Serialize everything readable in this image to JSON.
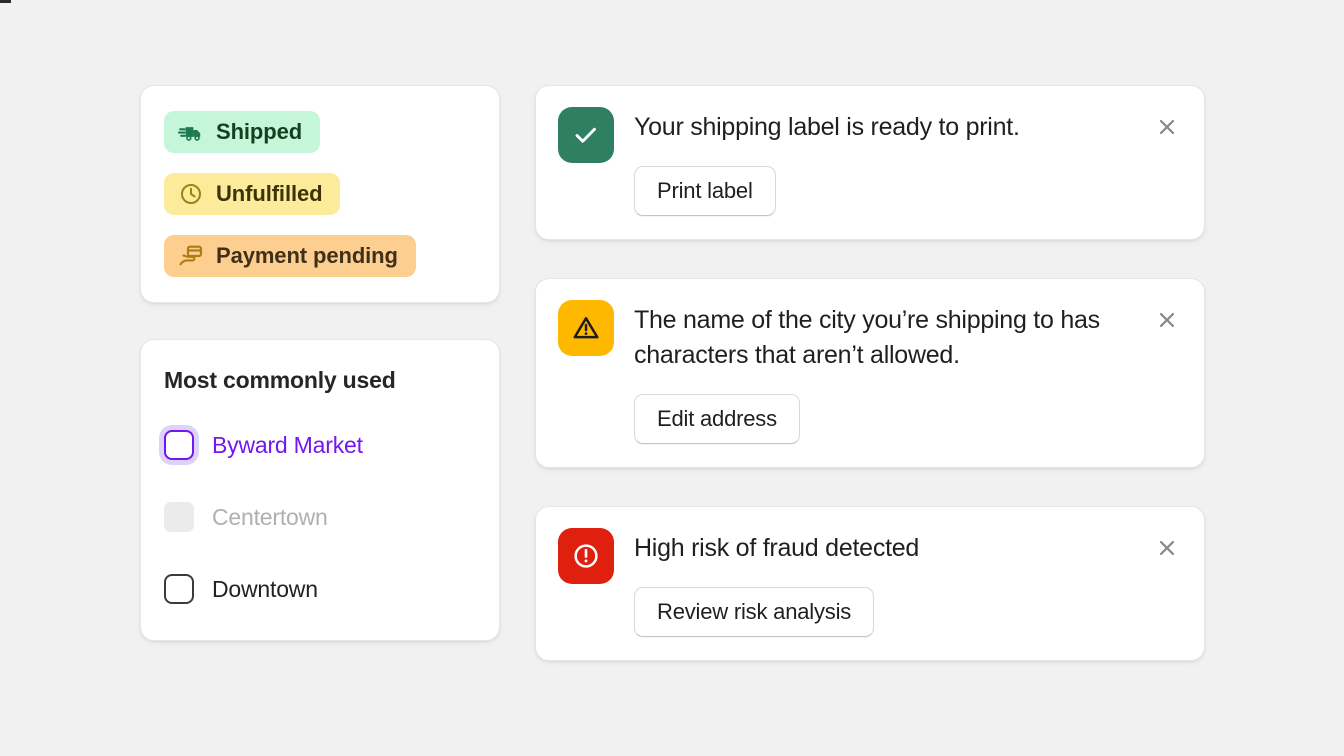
{
  "background_color": "#f1f1f1",
  "badges": {
    "items": [
      {
        "label": "Shipped",
        "tone": "success",
        "icon": "delivery-truck-icon",
        "bg": "#c6f6d9",
        "fg": "#14401f"
      },
      {
        "label": "Unfulfilled",
        "tone": "warning",
        "icon": "clock-icon",
        "bg": "#fbeb9b",
        "fg": "#3d3208"
      },
      {
        "label": "Payment pending",
        "tone": "attention",
        "icon": "credit-card-hand-icon",
        "bg": "#fcce8f",
        "fg": "#40301a"
      }
    ]
  },
  "choices": {
    "title": "Most commonly used",
    "items": [
      {
        "label": "Byward Market",
        "state": "focused",
        "checked": false,
        "accent": "#7316ef"
      },
      {
        "label": "Centertown",
        "state": "disabled",
        "checked": false,
        "accent": "#b0b0b0"
      },
      {
        "label": "Downtown",
        "state": "default",
        "checked": false,
        "accent": "#3b3b3b"
      }
    ]
  },
  "banners": [
    {
      "tone": "success",
      "icon": "check-icon",
      "icon_bg": "#2f8062",
      "message": "Your shipping label is ready to print.",
      "action_label": "Print label",
      "close_icon": "close-icon"
    },
    {
      "tone": "warning",
      "icon": "warning-triangle-icon",
      "icon_bg": "#ffb800",
      "message": "The name of the city you’re shipping to has characters that aren’t allowed.",
      "action_label": "Edit address",
      "close_icon": "close-icon"
    },
    {
      "tone": "critical",
      "icon": "alert-circle-icon",
      "icon_bg": "#e0200e",
      "message": "High risk of fraud detected",
      "action_label": "Review risk analysis",
      "close_icon": "close-icon"
    }
  ]
}
